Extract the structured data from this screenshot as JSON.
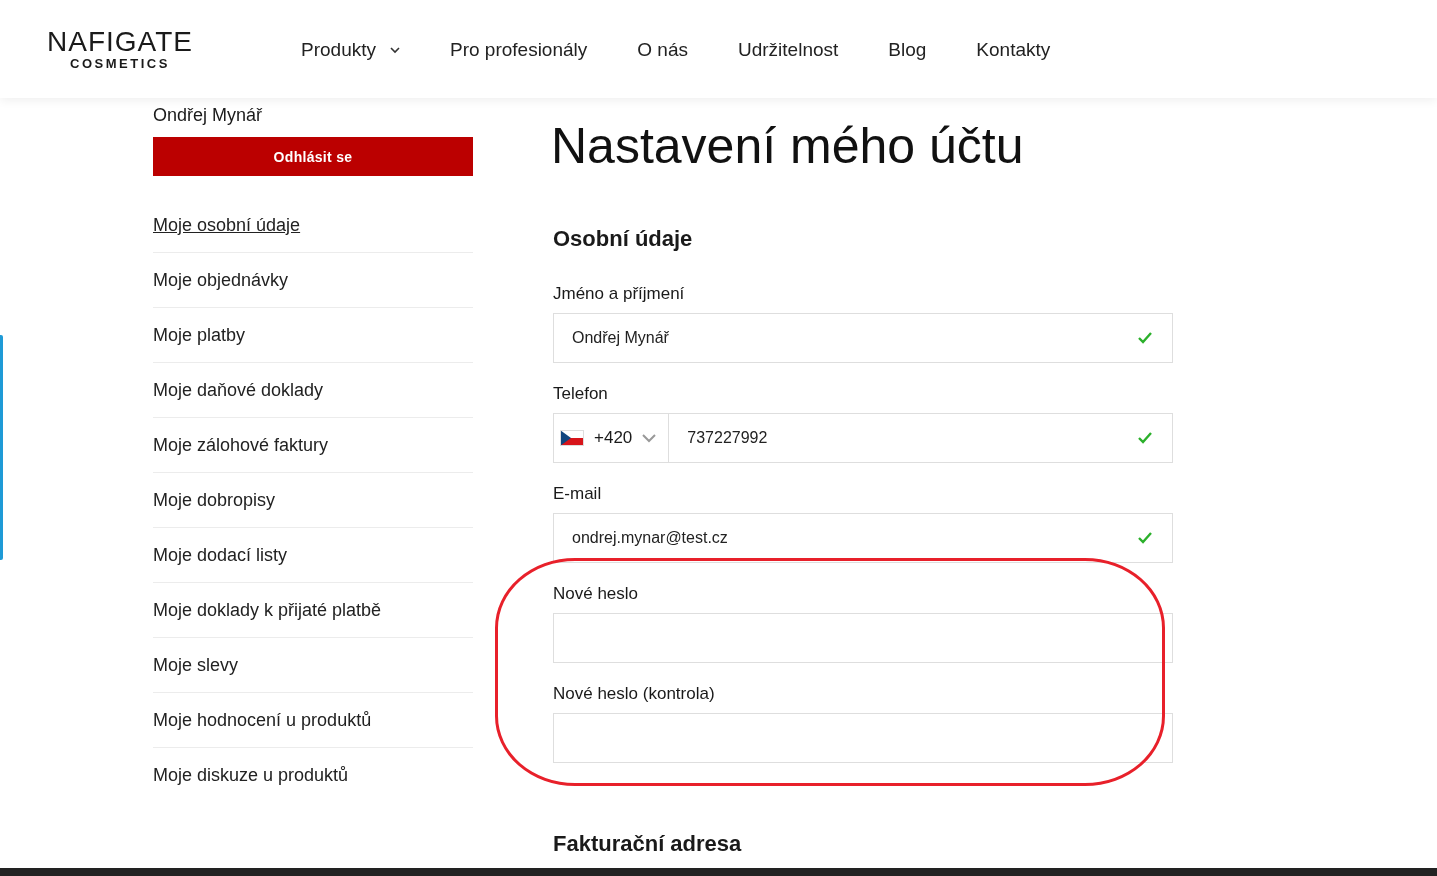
{
  "header": {
    "logo": {
      "name": "NAFIGATE",
      "sub": "COSMETICS"
    },
    "nav": [
      {
        "label": "Produkty",
        "kind": "dropdown"
      },
      {
        "label": "Pro profesionály",
        "kind": "link"
      },
      {
        "label": "O nás",
        "kind": "link"
      },
      {
        "label": "Udržitelnost",
        "kind": "link"
      },
      {
        "label": "Blog",
        "kind": "link"
      },
      {
        "label": "Kontakty",
        "kind": "link"
      }
    ]
  },
  "sidebar": {
    "user": "Ondřej Mynář",
    "logout": "Odhlásit se",
    "items": [
      {
        "label": "Moje osobní údaje",
        "selected": true
      },
      {
        "label": "Moje objednávky",
        "selected": false
      },
      {
        "label": "Moje platby",
        "selected": false
      },
      {
        "label": "Moje daňové doklady",
        "selected": false
      },
      {
        "label": "Moje zálohové faktury",
        "selected": false
      },
      {
        "label": "Moje dobropisy",
        "selected": false
      },
      {
        "label": "Moje dodací listy",
        "selected": false
      },
      {
        "label": "Moje doklady k přijaté platbě",
        "selected": false
      },
      {
        "label": "Moje slevy",
        "selected": false
      },
      {
        "label": "Moje hodnocení u produktů",
        "selected": false
      },
      {
        "label": "Moje diskuze u produktů",
        "selected": false
      }
    ]
  },
  "main": {
    "title": "Nastavení mého účtu",
    "section": "Osobní údaje",
    "fields": [
      {
        "kind": "text",
        "label": "Jméno a příjmení",
        "value": "Ondřej Mynář",
        "valid": true
      },
      {
        "kind": "phone",
        "label": "Telefon",
        "prefix": "+420",
        "value": "737227992",
        "valid": true
      },
      {
        "kind": "text",
        "label": "E-mail",
        "value": "ondrej.mynar@test.cz",
        "valid": true
      },
      {
        "kind": "password",
        "label": "Nové heslo",
        "valid": false
      },
      {
        "kind": "password",
        "label": "Nové heslo (kontrola)",
        "valid": false
      }
    ],
    "next_section": "Fakturační adresa"
  }
}
